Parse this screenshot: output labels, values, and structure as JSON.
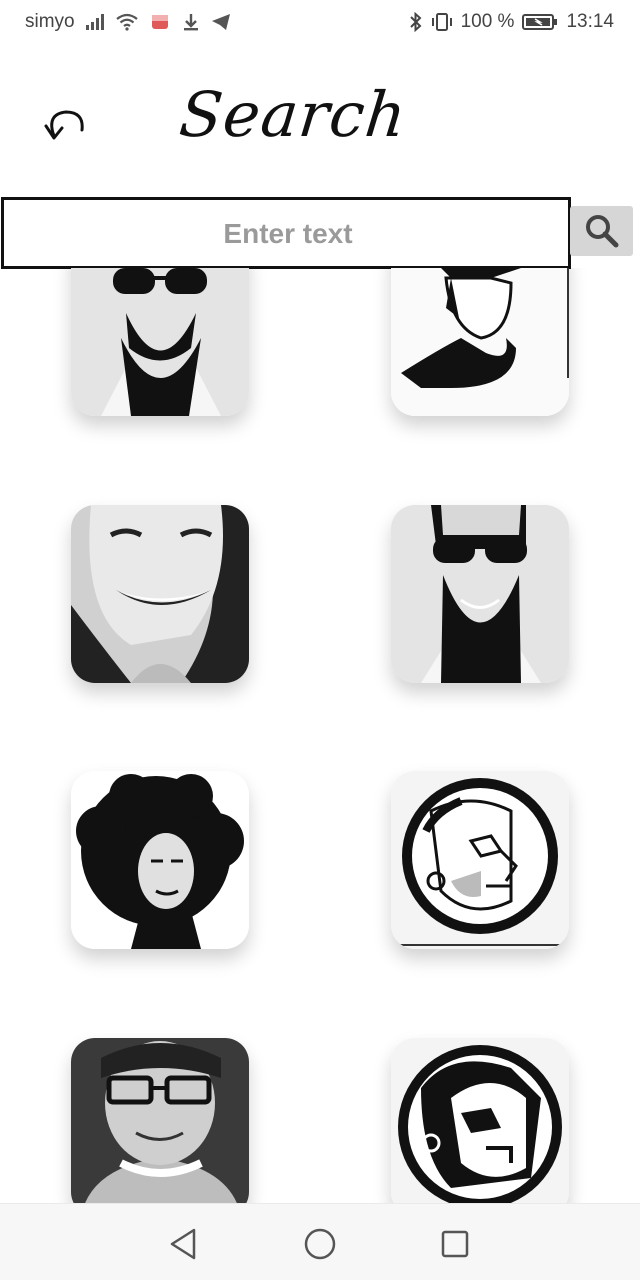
{
  "status_bar": {
    "carrier": "simyo",
    "battery": "100 %",
    "time": "13:14"
  },
  "header": {
    "title": "Search",
    "back_icon": "undo-arrow-icon"
  },
  "search": {
    "placeholder": "Enter text",
    "value": "",
    "button_icon": "search-icon"
  },
  "results": [
    {
      "name": "bearded-man-sunglasses"
    },
    {
      "name": "man-portrait-profile"
    },
    {
      "name": "smiling-woman"
    },
    {
      "name": "bearded-man-sunglasses"
    },
    {
      "name": "woman-afro-hair"
    },
    {
      "name": "circular-face-logo"
    },
    {
      "name": "man-with-glasses"
    },
    {
      "name": "circular-face-logo-2"
    }
  ],
  "nav_bar": {
    "back_icon": "triangle-back-icon",
    "home_icon": "circle-home-icon",
    "recents_icon": "square-recents-icon"
  }
}
